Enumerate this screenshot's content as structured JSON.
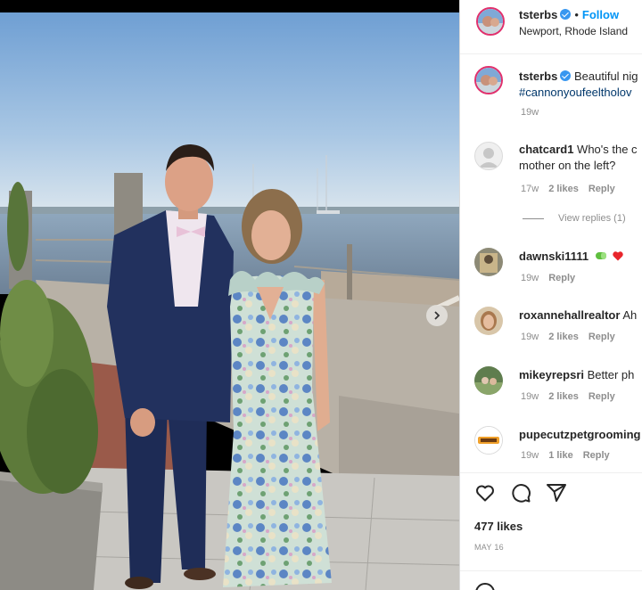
{
  "post": {
    "username": "tsterbs",
    "follow_label": "Follow",
    "separator": "•",
    "location": "Newport, Rhode Island"
  },
  "caption": {
    "username": "tsterbs",
    "text": "Beautiful nig",
    "hashtag": "#cannonyoufeeltholov",
    "time": "19w"
  },
  "comments": [
    {
      "username": "chatcard1",
      "text_line1": "Who's the c",
      "text_line2": "mother on the left?",
      "time": "17w",
      "likes": "2 likes",
      "reply": "Reply",
      "view_replies": "View replies (1)"
    },
    {
      "username": "dawnski1111",
      "text": "",
      "time": "19w",
      "reply": "Reply",
      "emoji": [
        "pill-emoji",
        "red-heart-emoji"
      ]
    },
    {
      "username": "roxannehallrealtor",
      "text": "Ah",
      "time": "19w",
      "likes": "2 likes",
      "reply": "Reply"
    },
    {
      "username": "mikeyrepsri",
      "text": "Better ph",
      "time": "19w",
      "likes": "2 likes",
      "reply": "Reply"
    },
    {
      "username": "pupecutzpetgrooming",
      "text": "",
      "time": "19w",
      "likes": "1 like",
      "reply": "Reply"
    }
  ],
  "actions": {
    "likes": "477 likes",
    "date": "MAY 16"
  },
  "colors": {
    "link": "#0095f6",
    "hashtag": "#00376b",
    "muted": "#8e8e8e",
    "heart": "#ed4956"
  },
  "icons": [
    "verified-badge-icon",
    "heart-icon",
    "comment-icon",
    "share-icon",
    "next-arrow-icon",
    "emoji-icon"
  ]
}
